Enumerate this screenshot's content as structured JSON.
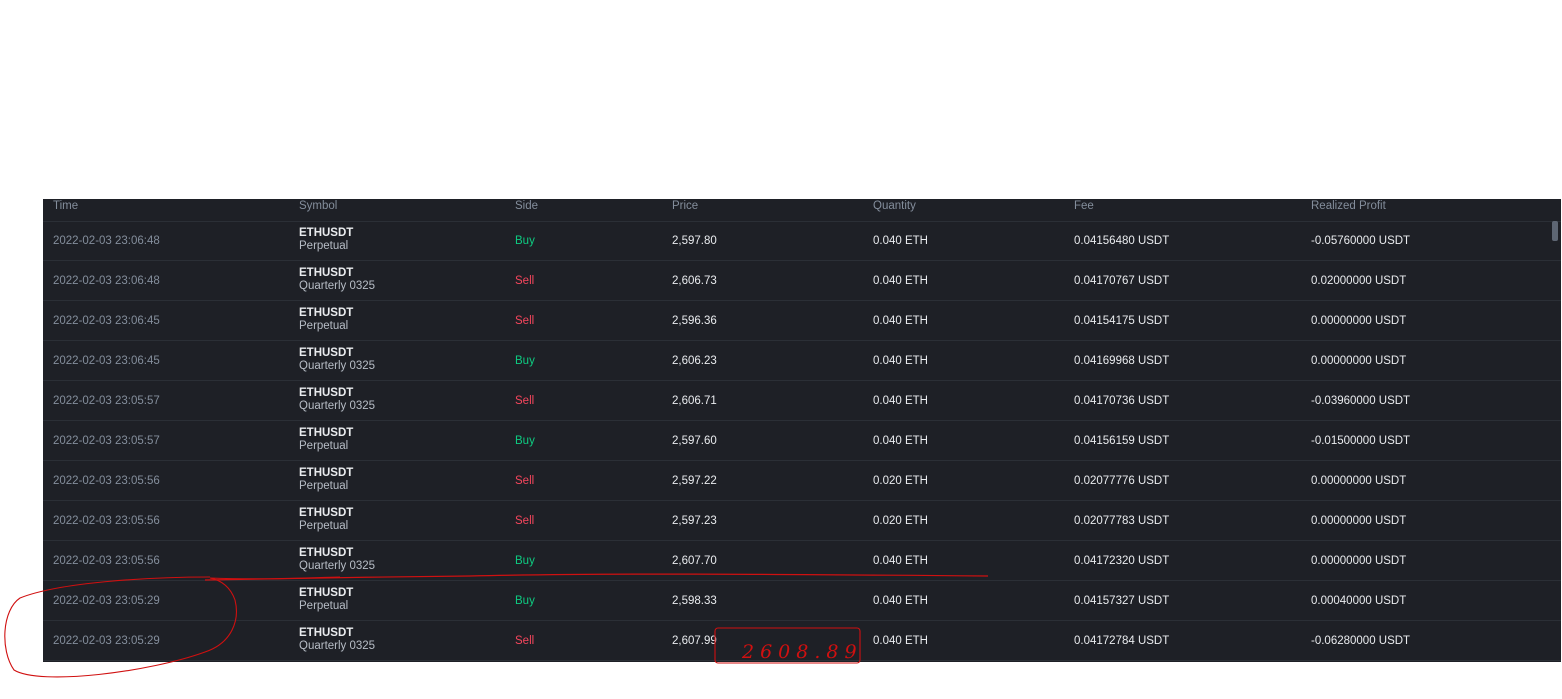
{
  "table": {
    "columns": {
      "time": "Time",
      "symbol": "Symbol",
      "side": "Side",
      "price": "Price",
      "quantity": "Quantity",
      "fee": "Fee",
      "realized_profit": "Realized Profit"
    },
    "rows": [
      {
        "time": "2022-02-03 23:06:48",
        "symbol": "ETHUSDT",
        "contract": "Perpetual",
        "side": "Buy",
        "price": "2,597.80",
        "quantity": "0.040 ETH",
        "fee": "0.04156480 USDT",
        "realized_profit": "-0.05760000 USDT"
      },
      {
        "time": "2022-02-03 23:06:48",
        "symbol": "ETHUSDT",
        "contract": "Quarterly 0325",
        "side": "Sell",
        "price": "2,606.73",
        "quantity": "0.040 ETH",
        "fee": "0.04170767 USDT",
        "realized_profit": "0.02000000 USDT"
      },
      {
        "time": "2022-02-03 23:06:45",
        "symbol": "ETHUSDT",
        "contract": "Perpetual",
        "side": "Sell",
        "price": "2,596.36",
        "quantity": "0.040 ETH",
        "fee": "0.04154175 USDT",
        "realized_profit": "0.00000000 USDT"
      },
      {
        "time": "2022-02-03 23:06:45",
        "symbol": "ETHUSDT",
        "contract": "Quarterly 0325",
        "side": "Buy",
        "price": "2,606.23",
        "quantity": "0.040 ETH",
        "fee": "0.04169968 USDT",
        "realized_profit": "0.00000000 USDT"
      },
      {
        "time": "2022-02-03 23:05:57",
        "symbol": "ETHUSDT",
        "contract": "Quarterly 0325",
        "side": "Sell",
        "price": "2,606.71",
        "quantity": "0.040 ETH",
        "fee": "0.04170736 USDT",
        "realized_profit": "-0.03960000 USDT"
      },
      {
        "time": "2022-02-03 23:05:57",
        "symbol": "ETHUSDT",
        "contract": "Perpetual",
        "side": "Buy",
        "price": "2,597.60",
        "quantity": "0.040 ETH",
        "fee": "0.04156159 USDT",
        "realized_profit": "-0.01500000 USDT"
      },
      {
        "time": "2022-02-03 23:05:56",
        "symbol": "ETHUSDT",
        "contract": "Perpetual",
        "side": "Sell",
        "price": "2,597.22",
        "quantity": "0.020 ETH",
        "fee": "0.02077776 USDT",
        "realized_profit": "0.00000000 USDT"
      },
      {
        "time": "2022-02-03 23:05:56",
        "symbol": "ETHUSDT",
        "contract": "Perpetual",
        "side": "Sell",
        "price": "2,597.23",
        "quantity": "0.020 ETH",
        "fee": "0.02077783 USDT",
        "realized_profit": "0.00000000 USDT"
      },
      {
        "time": "2022-02-03 23:05:56",
        "symbol": "ETHUSDT",
        "contract": "Quarterly 0325",
        "side": "Buy",
        "price": "2,607.70",
        "quantity": "0.040 ETH",
        "fee": "0.04172320 USDT",
        "realized_profit": "0.00000000 USDT"
      },
      {
        "time": "2022-02-03 23:05:29",
        "symbol": "ETHUSDT",
        "contract": "Perpetual",
        "side": "Buy",
        "price": "2,598.33",
        "quantity": "0.040 ETH",
        "fee": "0.04157327 USDT",
        "realized_profit": "0.00040000 USDT"
      },
      {
        "time": "2022-02-03 23:05:29",
        "symbol": "ETHUSDT",
        "contract": "Quarterly 0325",
        "side": "Sell",
        "price": "2,607.99",
        "quantity": "0.040 ETH",
        "fee": "0.04172784 USDT",
        "realized_profit": "-0.06280000 USDT"
      }
    ]
  },
  "annotations": {
    "handwritten_note": "2608.89"
  },
  "colors": {
    "panel_bg": "#1e2026",
    "header_text": "#848e9c",
    "buy": "#0ecb81",
    "sell": "#f6465d",
    "annotation_ink": "#d01010"
  }
}
